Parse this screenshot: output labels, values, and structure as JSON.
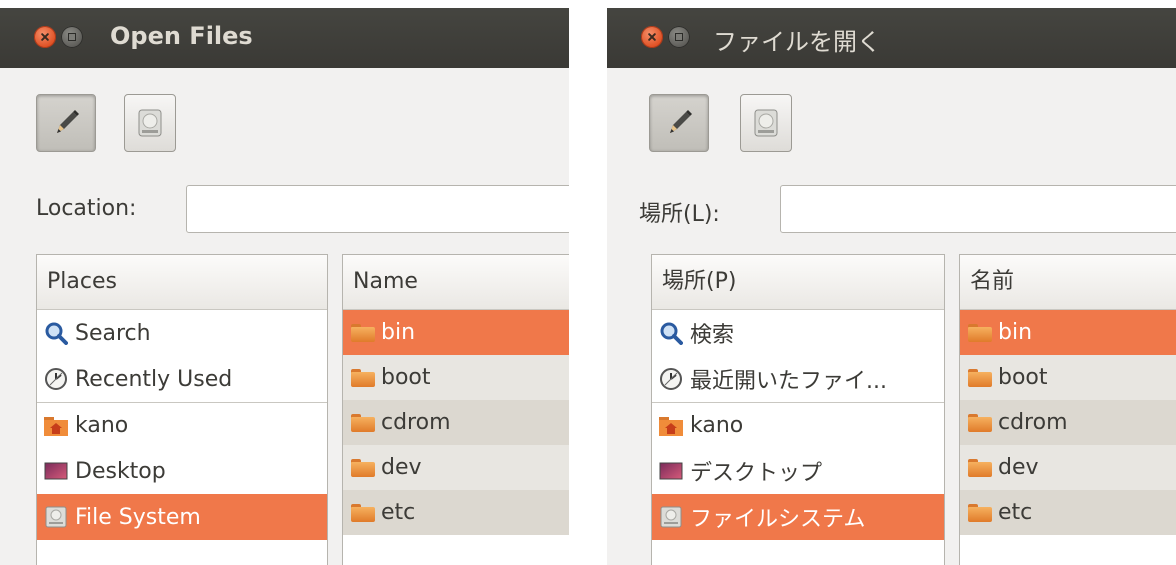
{
  "panels": [
    {
      "window_title": "Open Files",
      "location_label": "Location:",
      "location_value": "",
      "places_header": "Places",
      "name_header": "Name",
      "places": [
        {
          "label": "Search",
          "icon": "magnifier-icon",
          "selected": false
        },
        {
          "label": "Recently Used",
          "icon": "clock-icon",
          "selected": false
        },
        {
          "label": "kano",
          "icon": "home-folder-icon",
          "selected": false
        },
        {
          "label": "Desktop",
          "icon": "desktop-icon",
          "selected": false
        },
        {
          "label": "File System",
          "icon": "harddrive-icon",
          "selected": true
        }
      ],
      "files": [
        "bin",
        "boot",
        "cdrom",
        "dev",
        "etc"
      ]
    },
    {
      "window_title": "ファイルを開く",
      "location_label": "場所(L):",
      "location_value": "",
      "places_header": "場所(P)",
      "name_header": "名前",
      "places": [
        {
          "label": "検索",
          "icon": "magnifier-icon",
          "selected": false
        },
        {
          "label": "最近開いたファイ...",
          "icon": "clock-icon",
          "selected": false
        },
        {
          "label": "kano",
          "icon": "home-folder-icon",
          "selected": false
        },
        {
          "label": "デスクトップ",
          "icon": "desktop-icon",
          "selected": false
        },
        {
          "label": "ファイルシステム",
          "icon": "harddrive-icon",
          "selected": true
        }
      ],
      "files": [
        "bin",
        "boot",
        "cdrom",
        "dev",
        "etc"
      ]
    }
  ],
  "colors": {
    "selection": "#f0784a",
    "titlebar": "#3c3b37",
    "window_bg": "#f2f1f0",
    "close_button": "#df4f22"
  }
}
